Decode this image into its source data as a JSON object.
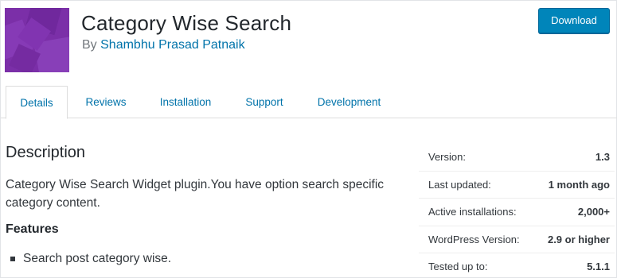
{
  "plugin": {
    "title": "Category Wise Search",
    "author_prefix": "By",
    "author": "Shambhu Prasad Patnaik",
    "icon_color": "#7b2fa8"
  },
  "actions": {
    "download_label": "Download"
  },
  "tabs": [
    {
      "label": "Details",
      "active": true
    },
    {
      "label": "Reviews",
      "active": false
    },
    {
      "label": "Installation",
      "active": false
    },
    {
      "label": "Support",
      "active": false
    },
    {
      "label": "Development",
      "active": false
    }
  ],
  "main": {
    "description_title": "Description",
    "description_text": "Category Wise Search Widget plugin.You have option search specific category content.",
    "features_title": "Features",
    "features": [
      "Search post category wise."
    ]
  },
  "meta": [
    {
      "label": "Version:",
      "value": "1.3"
    },
    {
      "label": "Last updated:",
      "value": "1 month ago"
    },
    {
      "label": "Active installations:",
      "value": "2,000+"
    },
    {
      "label": "WordPress Version:",
      "value": "2.9 or higher"
    },
    {
      "label": "Tested up to:",
      "value": "5.1.1"
    }
  ]
}
